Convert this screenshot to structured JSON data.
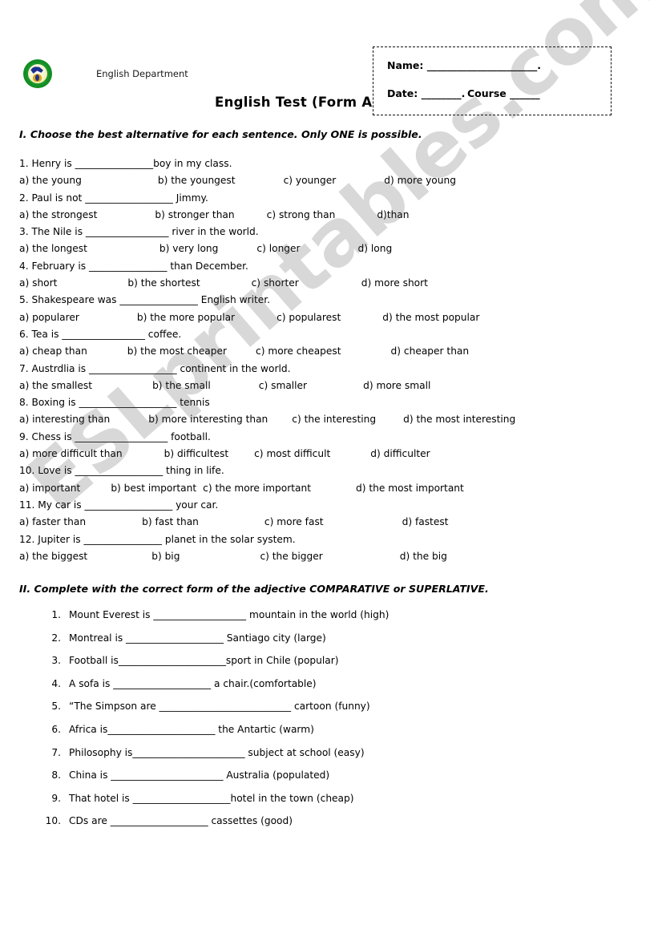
{
  "document": {
    "type": "worksheet",
    "watermark": "ESLprintables.com",
    "logo_icon": "english-department-logo-icon",
    "department_label": "English Department",
    "title": "English Test    (Form A"
  },
  "student_box": {
    "name_label": "Name:",
    "name_line": "______________________.",
    "date_label": "Date:",
    "date_line": "________.",
    "course_label": "Course",
    "course_line": "______"
  },
  "section_1": {
    "heading": "I. Choose the best alternative for each sentence. Only ONE is possible.",
    "questions": [
      {
        "stem": "1. Henry is ________________boy in my class.",
        "options": [
          "a) the young",
          "b) the youngest",
          "c) younger",
          "d) more young"
        ],
        "gaps": [
          95,
          60,
          60,
          0
        ]
      },
      {
        "stem": "2. Paul is not  __________________ Jimmy.",
        "options": [
          "a) the strongest",
          "b) stronger than",
          "c) strong  than",
          "d)than"
        ],
        "gaps": [
          72,
          40,
          52,
          0
        ]
      },
      {
        "stem": "3. The Nile is _________________ river in the world.",
        "options": [
          "a) the longest",
          "b) very long",
          "c) longer",
          "d) long"
        ],
        "gaps": [
          90,
          48,
          72,
          0
        ]
      },
      {
        "stem": "4. February is ________________ than December.",
        "options": [
          "a) short",
          "b) the shortest",
          "c) shorter",
          "d) more short"
        ],
        "gaps": [
          88,
          64,
          78,
          0
        ]
      },
      {
        "stem": "5. Shakespeare was  ________________ English writer.",
        "options": [
          "a) popularer",
          "b) the more popular",
          "c) popularest",
          "d) the most popular"
        ],
        "gaps": [
          72,
          52,
          52,
          0
        ]
      },
      {
        "stem": "6. Tea is _________________ coffee.",
        "options": [
          "a) cheap than",
          "b) the most cheaper",
          "c) more cheapest",
          "d) cheaper than"
        ],
        "gaps": [
          50,
          36,
          62,
          0
        ]
      },
      {
        "stem": "7. Austrdlia is __________________ continent in the world.",
        "options": [
          "a) the smallest",
          "b) the small",
          "c) smaller",
          "d) more small"
        ],
        "gaps": [
          75,
          60,
          70,
          0
        ]
      },
      {
        "stem": "8. Boxing is ____________________ tennis",
        "options": [
          "a) interesting than",
          "b) more interesting than",
          "c) the interesting",
          "d) the most interesting"
        ],
        "gaps": [
          48,
          30,
          34,
          0
        ]
      },
      {
        "stem": "9. Chess is ___________________ football.",
        "options": [
          "a) more difficult   than",
          "b) difficultest",
          "c) most difficult",
          "d) difficulter"
        ],
        "gaps": [
          52,
          32,
          50,
          0
        ]
      },
      {
        "stem": "10. Love is __________________ thing in life.",
        "options": [
          "a) important",
          "b) best important",
          "c) the more important",
          "d) the most important"
        ],
        "gaps": [
          38,
          8,
          56,
          0
        ]
      },
      {
        "stem": "11. My car is __________________ your car.",
        "options": [
          "a) faster  than",
          "b) fast    than",
          "c) more fast",
          "d) fastest"
        ],
        "gaps": [
          70,
          82,
          98,
          0
        ]
      },
      {
        "stem": "12. Jupiter is ________________ planet in the solar system.",
        "options": [
          "a) the biggest",
          "b) big",
          "c) the bigger",
          "d) the big"
        ],
        "gaps": [
          80,
          100,
          96,
          0
        ]
      }
    ]
  },
  "section_2": {
    "heading": "II. Complete with the correct form of the adjective COMPARATIVE or SUPERLATIVE.",
    "items": [
      {
        "number": "1.",
        "text": "Mount Everest is ___________________ mountain in the world (high)"
      },
      {
        "number": "2.",
        "text": "Montreal is ____________________ Santiago city (large)"
      },
      {
        "number": "3.",
        "text": "Football is______________________sport in Chile (popular)"
      },
      {
        "number": "4.",
        "text": "A sofa is ____________________ a chair.(comfortable)"
      },
      {
        "number": "5.",
        "text": "“The Simpson are ___________________________ cartoon (funny)"
      },
      {
        "number": "6.",
        "text": "Africa is______________________ the Antartic (warm)"
      },
      {
        "number": "7.",
        "text": "Philosophy is_______________________ subject at school (easy)"
      },
      {
        "number": "8.",
        "text": "China is _______________________ Australia (populated)"
      },
      {
        "number": "9.",
        "text": "That hotel is ____________________hotel in the town (cheap)"
      },
      {
        "number": "10.",
        "text": "CDs are ____________________ cassettes (good)"
      }
    ]
  }
}
